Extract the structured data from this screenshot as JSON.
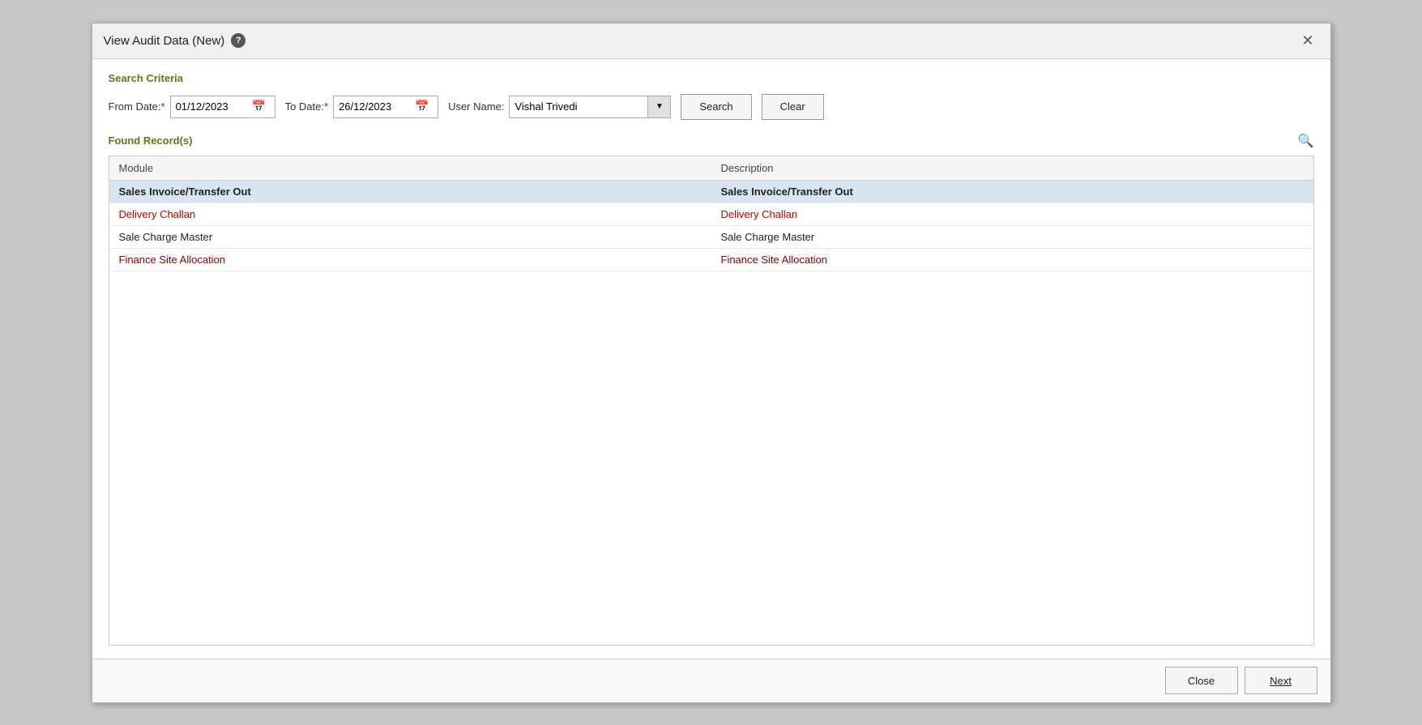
{
  "dialog": {
    "title": "View Audit Data (New)",
    "help_icon": "?",
    "close_label": "✕"
  },
  "search_criteria": {
    "section_label": "Search Criteria",
    "from_date_label": "From Date:",
    "from_date_required": "*",
    "from_date_value": "01/12/2023",
    "to_date_label": "To Date:",
    "to_date_required": "*",
    "to_date_value": "26/12/2023",
    "user_name_label": "User Name:",
    "user_name_value": "Vishal Trivedi",
    "search_button": "Search",
    "clear_button": "Clear"
  },
  "found_records": {
    "section_label": "Found Record(s)",
    "columns": [
      "Module",
      "Description"
    ],
    "rows": [
      {
        "module": "Sales Invoice/Transfer Out",
        "description": "Sales Invoice/Transfer Out",
        "style": "bold selected"
      },
      {
        "module": "Delivery Challan",
        "description": "Delivery Challan",
        "style": "red"
      },
      {
        "module": "Sale Charge Master",
        "description": "Sale Charge Master",
        "style": "normal"
      },
      {
        "module": "Finance Site Allocation",
        "description": "Finance Site Allocation",
        "style": "dark-red"
      }
    ]
  },
  "footer": {
    "close_button": "Close",
    "next_button": "Next"
  }
}
